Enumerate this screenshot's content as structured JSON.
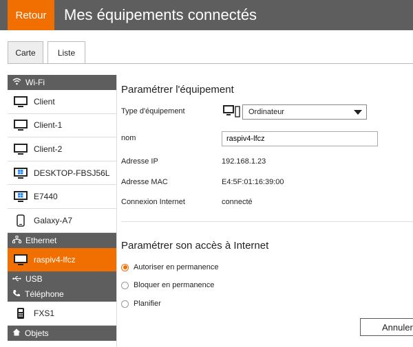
{
  "header": {
    "back_label": "Retour",
    "title": "Mes équipements connectés"
  },
  "tabs": [
    {
      "label": "Carte"
    },
    {
      "label": "Liste",
      "active": true
    }
  ],
  "sidebar": {
    "wifi": {
      "label": "Wi-Fi",
      "icon": "wifi-icon"
    },
    "wifi_devices": [
      {
        "label": "Client",
        "icon": "monitor-icon"
      },
      {
        "label": "Client-1",
        "icon": "monitor-icon"
      },
      {
        "label": "Client-2",
        "icon": "monitor-icon"
      },
      {
        "label": "DESKTOP-FBSJ56L",
        "icon": "windows-monitor-icon"
      },
      {
        "label": "E7440",
        "icon": "windows-monitor-icon"
      },
      {
        "label": "Galaxy-A7",
        "icon": "smartphone-icon"
      }
    ],
    "ethernet": {
      "label": "Ethernet",
      "icon": "network-icon"
    },
    "ethernet_devices": [
      {
        "label": "raspiv4-lfcz",
        "icon": "monitor-icon",
        "selected": true
      }
    ],
    "usb": {
      "label": "USB",
      "icon": "usb-icon"
    },
    "telephone": {
      "label": "Téléphone",
      "icon": "phone-icon"
    },
    "telephone_devices": [
      {
        "label": "FXS1",
        "icon": "desk-phone-icon"
      }
    ],
    "objets": {
      "label": "Objets",
      "icon": "home-icon"
    }
  },
  "settings": {
    "title": "Paramétrer l'équipement",
    "type_label": "Type d'équipement",
    "type_value": "Ordinateur",
    "name_label": "nom",
    "name_value": "raspiv4-lfcz",
    "ip_label": "Adresse IP",
    "ip_value": "192.168.1.23",
    "mac_label": "Adresse MAC",
    "mac_value": "E4:5F:01:16:39:00",
    "internet_label": "Connexion Internet",
    "internet_value": "connecté"
  },
  "access": {
    "title": "Paramétrer son accès à Internet",
    "options": [
      {
        "label": "Autoriser en permanence",
        "checked": true
      },
      {
        "label": "Bloquer en permanence",
        "checked": false
      },
      {
        "label": "Planifier",
        "checked": false
      }
    ],
    "cancel_label": "Annuler"
  },
  "colors": {
    "accent": "#f16e00",
    "header_bg": "#5e5e5e"
  }
}
